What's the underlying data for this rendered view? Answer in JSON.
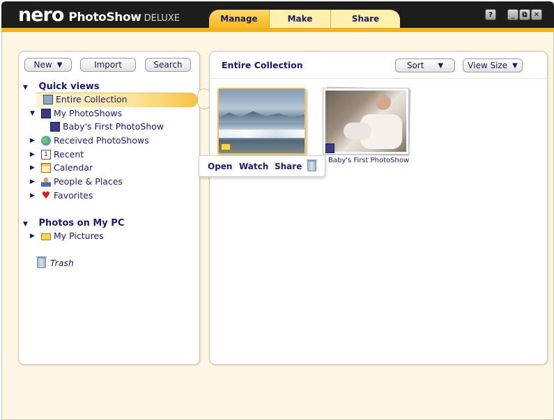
{
  "app": {
    "logo_nero": "nero",
    "logo_product": "PhotoShow",
    "logo_edition": "DELUXE"
  },
  "tabs": [
    {
      "label": "Manage",
      "active": true
    },
    {
      "label": "Make",
      "active": false
    },
    {
      "label": "Share",
      "active": false
    }
  ],
  "window_buttons": {
    "help": "?",
    "minimize": "_",
    "restore": "⧉",
    "close": "✕"
  },
  "toolbar": {
    "new_label": "New",
    "import_label": "Import",
    "search_label": "Search"
  },
  "sidebar": {
    "quick_views_header": "Quick views",
    "entire_collection": "Entire Collection",
    "my_photoshows": "My PhotoShows",
    "babys_first_photoshow": "Baby's First PhotoShow",
    "received_photoshows": "Received PhotoShows",
    "recent": "Recent",
    "calendar": "Calendar",
    "people_places": "People & Places",
    "favorites": "Favorites",
    "photos_on_pc_header": "Photos on My PC",
    "my_pictures": "My Pictures",
    "trash": "Trash",
    "recent_icon_text": "1"
  },
  "main": {
    "title": "Entire Collection",
    "sort_label": "Sort",
    "view_size_label": "View Size",
    "thumbnails": [
      {
        "caption": ""
      },
      {
        "caption": "Baby's First PhotoShow"
      }
    ],
    "popover": {
      "open": "Open",
      "watch": "Watch",
      "share": "Share"
    }
  },
  "colors": {
    "accent": "#f3b11e",
    "titlebar": "#1d1d1d",
    "text": "#1a1a6a",
    "frame_bg": "#fdf6e3"
  }
}
